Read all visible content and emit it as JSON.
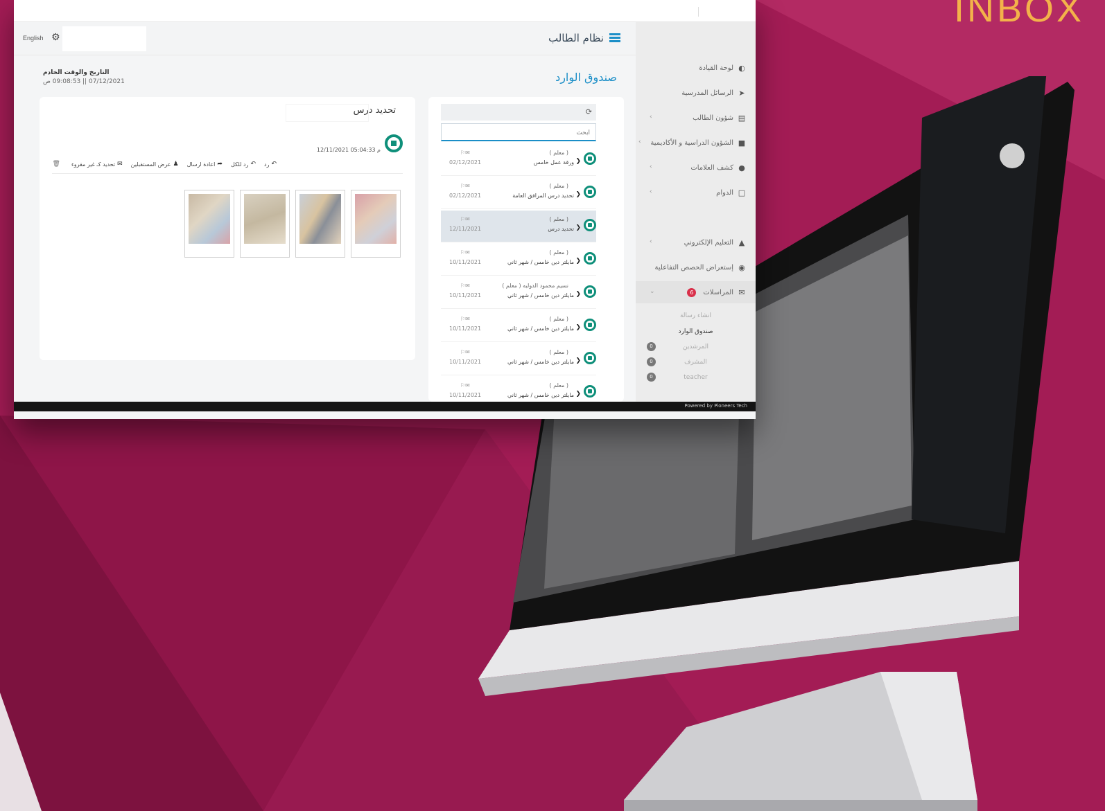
{
  "corner_title": "INBOX",
  "colors": {
    "background": "#a31c55",
    "accent": "#1a8ec7",
    "avatar": "#0e8f7a",
    "badge": "#d9304a"
  },
  "header": {
    "app_title": "نظام الطالب",
    "language": "English"
  },
  "page_title": "صندوق الوارد",
  "server_time": {
    "label": "التاريخ والوقت الخادم",
    "value": "07/12/2021 || 09:08:53 ص"
  },
  "sidebar": {
    "items": [
      {
        "label": "لوحة القيادة",
        "icon": "dashboard-icon"
      },
      {
        "label": "الرسائل المدرسية",
        "icon": "megaphone-icon"
      },
      {
        "label": "شؤون الطالب",
        "icon": "book-icon"
      },
      {
        "label": "الشؤون الدراسية و الأكاديمية",
        "icon": "briefcase-icon"
      },
      {
        "label": "كشف العلامات",
        "icon": "circle-icon"
      },
      {
        "label": "الدوام",
        "icon": "laptop-icon"
      },
      {
        "label": "التعليم الإلكتروني",
        "icon": "graduation-cap-icon"
      },
      {
        "label": "إستعراض الحصص التفاعلية",
        "icon": "camera-icon"
      },
      {
        "label": "المراسلات",
        "icon": "envelope-icon",
        "badge": "6"
      }
    ],
    "sub_items": [
      {
        "label": "انشاء رسالة"
      },
      {
        "label": "صندوق الوارد"
      },
      {
        "label": "المرشدين",
        "count": "0"
      },
      {
        "label": "المشرف",
        "count": "0"
      },
      {
        "label": "teacher",
        "count": "0"
      }
    ]
  },
  "list": {
    "search_placeholder": "ابحث",
    "messages": [
      {
        "who": "( معلم )",
        "subject": "ورقة عمل خامس",
        "date": "02/12/2021"
      },
      {
        "who": "( معلم )",
        "subject": "تحديد درس المرافق العامة",
        "date": "02/12/2021"
      },
      {
        "who": "( معلم )",
        "subject": "تحديد درس",
        "date": "12/11/2021"
      },
      {
        "who": "( معلم )",
        "subject": "مايلتر دين خامس / شهر ثاني",
        "date": "10/11/2021"
      },
      {
        "who": "نسيم محمود الدولبه ( معلم )",
        "subject": "مايلتر دين خامس / شهر ثاني",
        "date": "10/11/2021"
      },
      {
        "who": "( معلم )",
        "subject": "مايلتر دين خامس / شهر ثاني",
        "date": "10/11/2021"
      },
      {
        "who": "( معلم )",
        "subject": "مايلتر دين خامس / شهر ثاني",
        "date": "10/11/2021"
      },
      {
        "who": "( معلم )",
        "subject": "مايلتر دين خامس / شهر ثاني",
        "date": "10/11/2021"
      }
    ]
  },
  "detail": {
    "subject": "تحديد درس",
    "date": "12/11/2021 05:04:33 م",
    "actions": {
      "reply": "رد",
      "reply_all": "رد للكل",
      "forward": "اعادة ارسال",
      "recipients": "عرض المستقبلين",
      "mark_unread": "تحديد كـ غير مقروء"
    }
  },
  "footer": {
    "powered_by": "Powered by Pioneers Tech"
  }
}
